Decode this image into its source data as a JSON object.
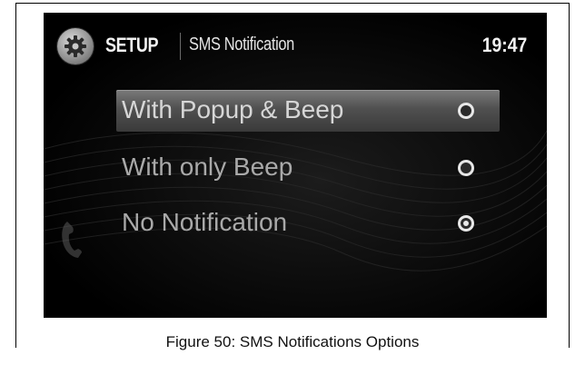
{
  "header": {
    "section": "SETUP",
    "page_title": "SMS Notification",
    "clock": "19:47",
    "setup_icon": "gear-icon"
  },
  "options": [
    {
      "label": "With Popup & Beep",
      "selected": false,
      "highlighted": true
    },
    {
      "label": "With only Beep",
      "selected": false,
      "highlighted": false
    },
    {
      "label": "No Notification",
      "selected": true,
      "highlighted": false
    }
  ],
  "side_icon": "phone-icon",
  "caption": "Figure 50: SMS Notifications Options",
  "colors": {
    "screen_background": "#000000",
    "highlight": "#5a5a5a",
    "text": "#a9a9a9",
    "radio": "#e8e8e8"
  }
}
